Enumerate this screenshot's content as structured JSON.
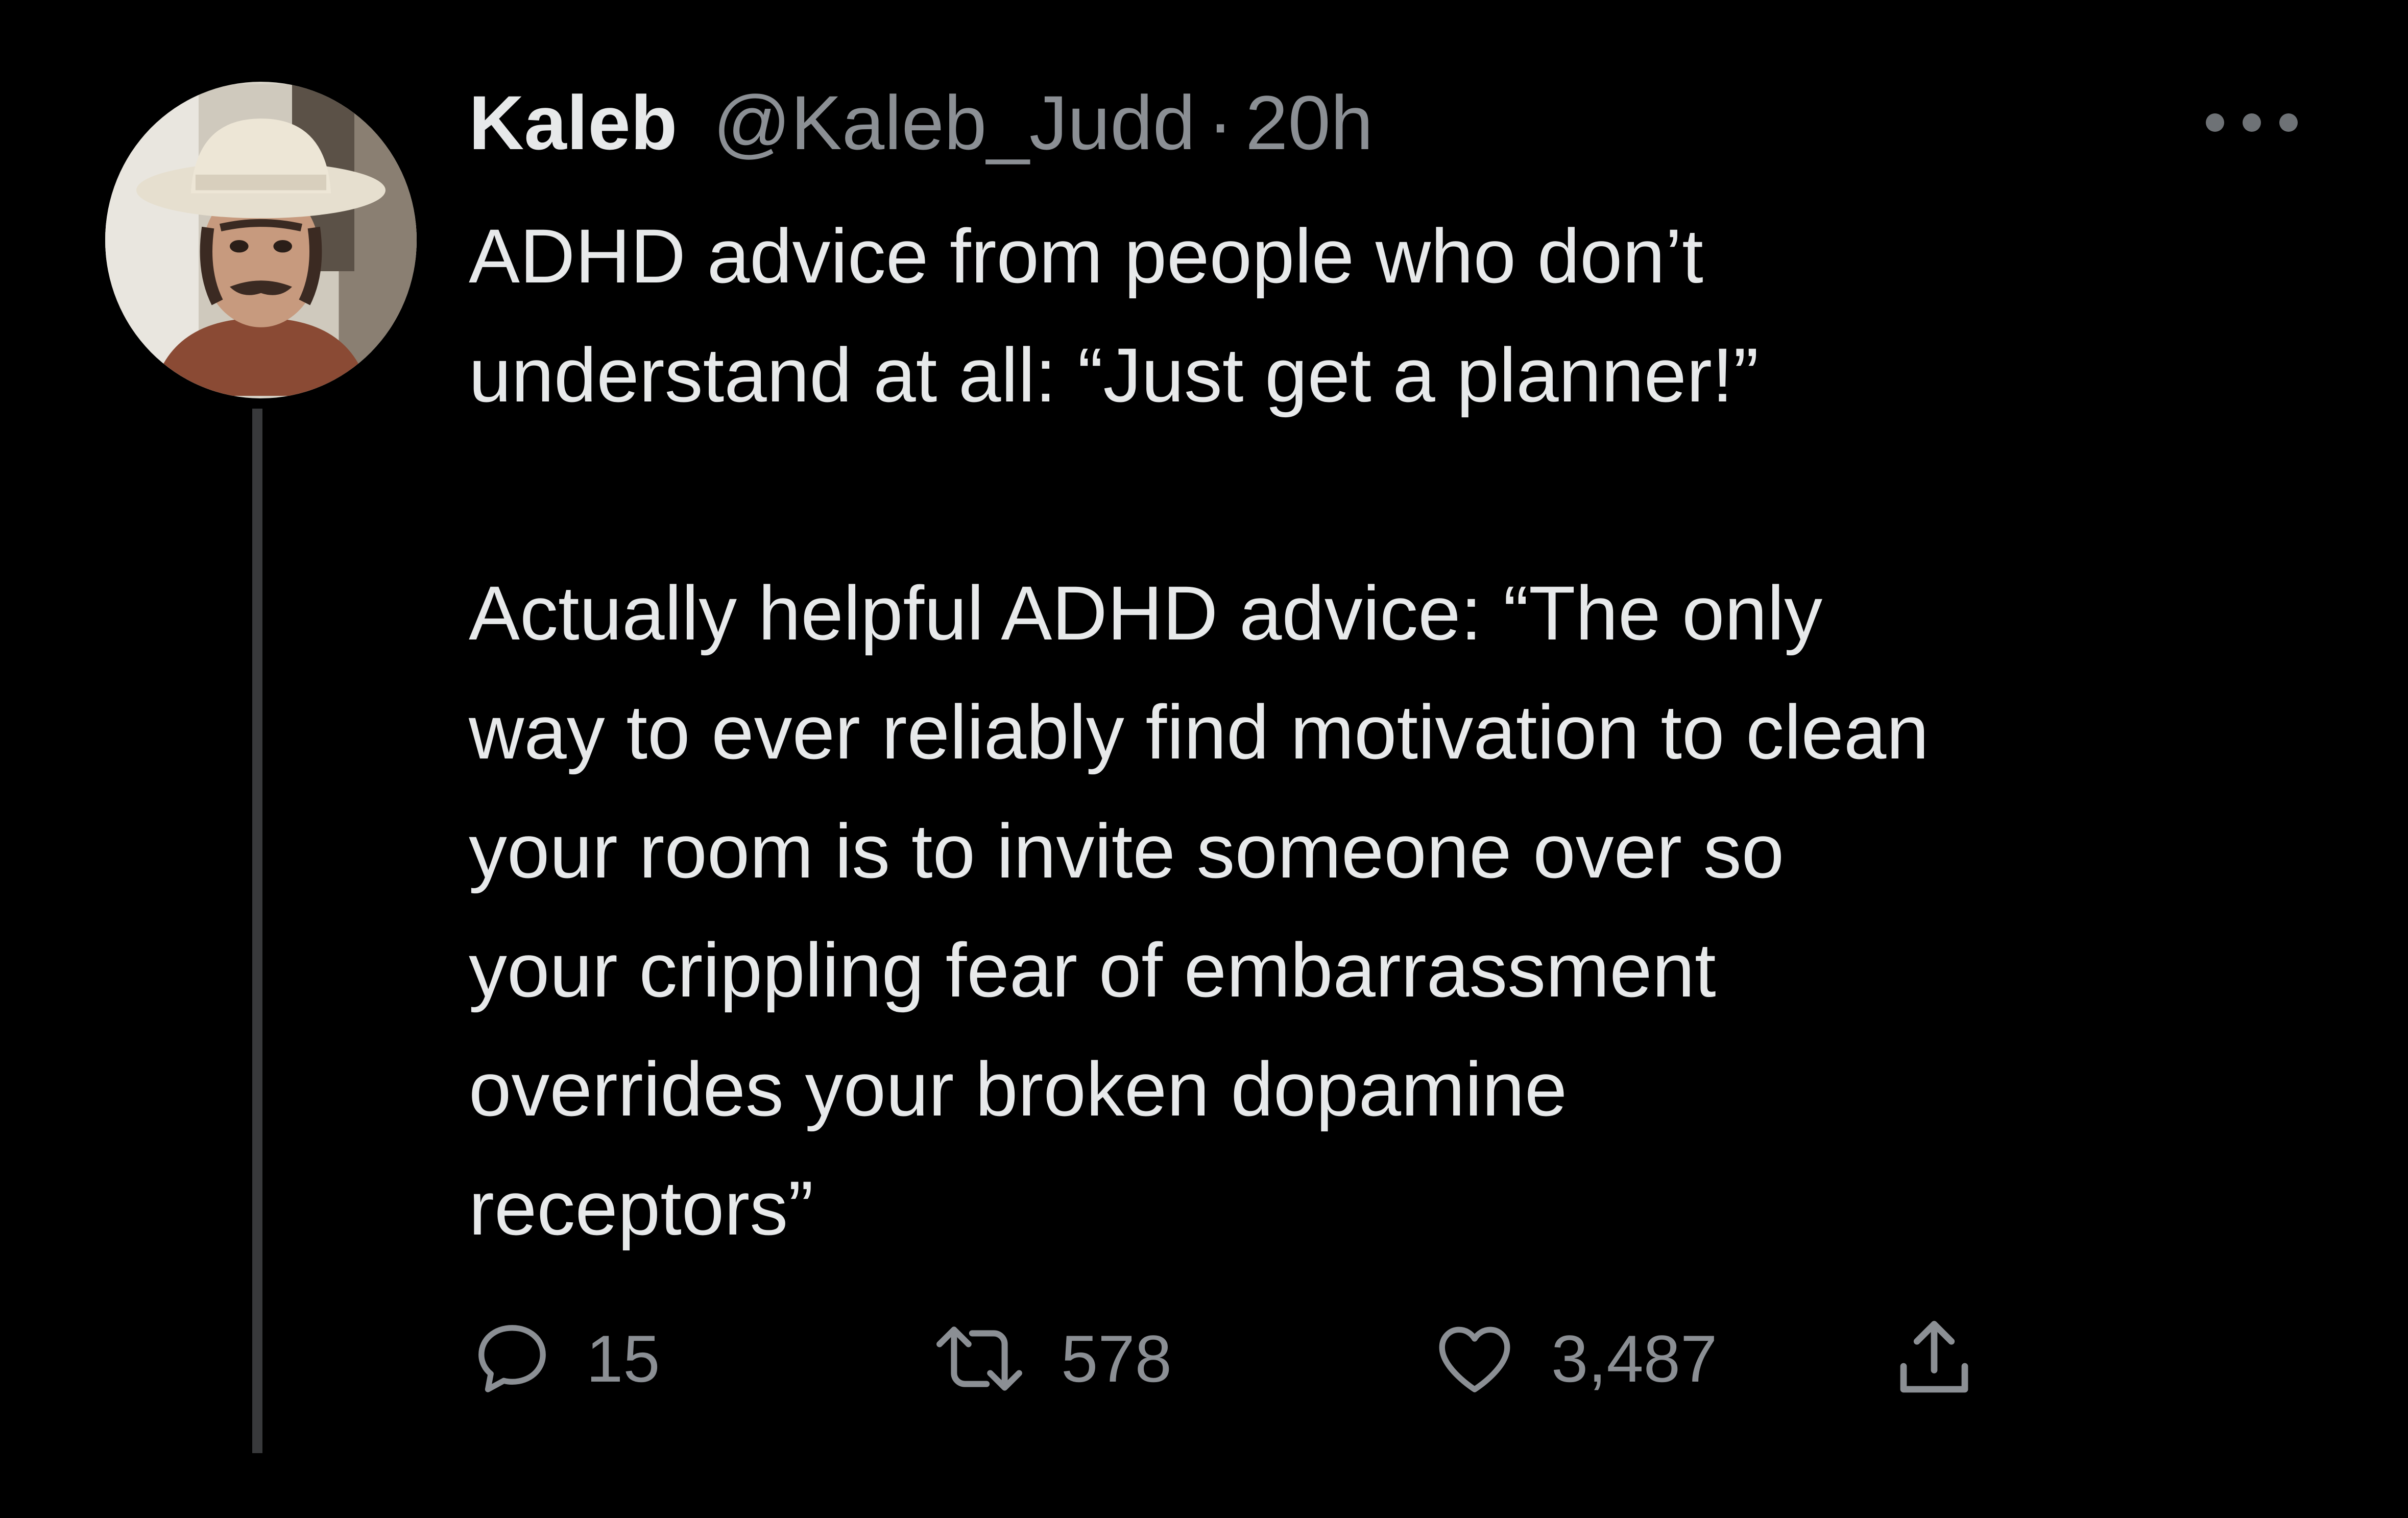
{
  "tweet": {
    "author_name": "Kaleb",
    "handle": "@Kaleb_Judd",
    "separator": "·",
    "time": "20h",
    "lines": [
      "ADHD advice from people who don’t",
      "understand at all: “Just get a planner!”",
      "",
      "Actually helpful ADHD advice: “The only",
      "way to ever reliably find motivation to clean",
      "your room is to invite someone over so",
      "your crippling fear of embarrassment",
      "overrides your broken dopamine",
      "receptors”"
    ],
    "stats": {
      "replies": "15",
      "retweets": "578",
      "likes": "3,487"
    }
  },
  "icons": {
    "more": "more-horizontal-icon",
    "reply": "reply-icon",
    "retweet": "retweet-icon",
    "like": "heart-icon",
    "share": "share-icon"
  },
  "colors": {
    "background": "#000000",
    "primary_text": "#e7e9ea",
    "secondary_text": "#8b8f94",
    "thread_line": "#38393b"
  }
}
